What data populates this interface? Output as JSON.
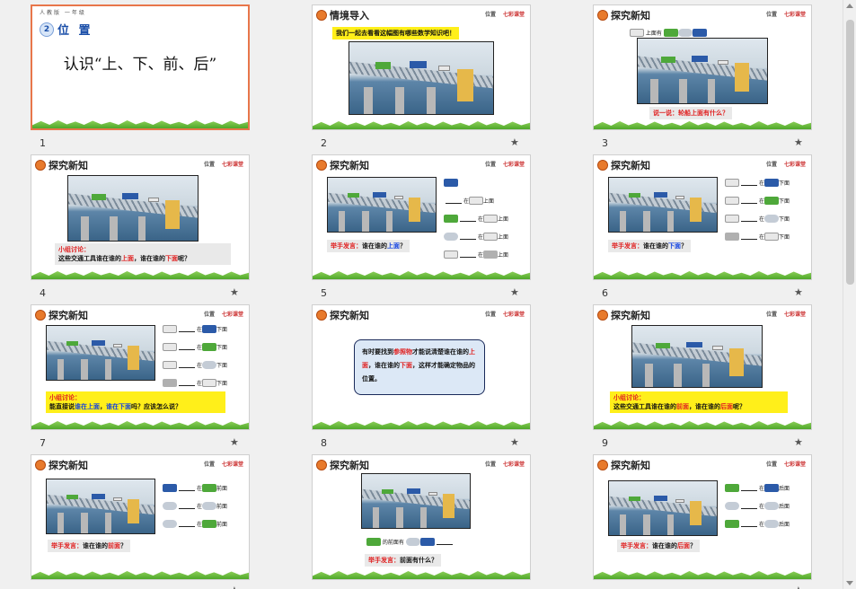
{
  "brand": {
    "prefix": "位置",
    "name": "七彩课堂"
  },
  "slides": [
    {
      "num": "1",
      "unit": "2",
      "unit_title": "位 置",
      "top_text": "人教版 一年级",
      "main_title": "认识“上、下、前、后”"
    },
    {
      "num": "2",
      "head": "情境导入",
      "banner": "我们一起去看看这幅图有哪些数学知识吧！"
    },
    {
      "num": "3",
      "head": "探究新知",
      "top_label": "上面有",
      "question": "说一说：轮船上面有什么？"
    },
    {
      "num": "4",
      "head": "探究新知",
      "disc_label": "小组讨论：",
      "disc_pre": "这些交通工具谁在谁的",
      "disc_up": "上面",
      "disc_mid": "，谁在谁的",
      "disc_down": "下面",
      "disc_end": "呢？"
    },
    {
      "num": "5",
      "head": "探究新知",
      "rows_word": "在",
      "rows_pos": "上面",
      "ask_label": "举手发言：",
      "ask_pre": "谁在谁的",
      "ask_key": "上面",
      "ask_end": "？"
    },
    {
      "num": "6",
      "head": "探究新知",
      "rows_word": "在",
      "rows_pos": "下面",
      "ask_label": "举手发言：",
      "ask_pre": "谁在谁的",
      "ask_key": "下面",
      "ask_end": "？"
    },
    {
      "num": "7",
      "head": "探究新知",
      "rows_word": "在",
      "rows_pos": "下面",
      "disc_label": "小组讨论：",
      "disc_pre": "能直接说",
      "disc_up": "谁在上面",
      "disc_mid": "，",
      "disc_down": "谁在下面",
      "disc_end": "吗？应该怎么说？"
    },
    {
      "num": "8",
      "head": "探究新知",
      "note_1": "有时要找到",
      "note_key": "参照物",
      "note_2": "才能说清楚谁在谁的",
      "note_up": "上面",
      "note_3": "，谁在谁的",
      "note_down": "下面",
      "note_4": "，这样才能确定物品的位置。"
    },
    {
      "num": "9",
      "head": "探究新知",
      "disc_label": "小组讨论：",
      "disc_pre": "这些交通工具谁在谁的",
      "disc_up": "前面",
      "disc_mid": "，谁在谁的",
      "disc_down": "后面",
      "disc_end": "呢？"
    },
    {
      "num": "10",
      "head": "探究新知",
      "rows_word": "在",
      "rows_pos": "前面",
      "ask_label": "举手发言：",
      "ask_pre": "谁在谁的",
      "ask_key": "前面",
      "ask_end": "？"
    },
    {
      "num": "11",
      "head": "探究新知",
      "bottom_label": "的前面有",
      "ask_label": "举手发言：",
      "ask_pre": "前面有什么",
      "ask_key": "",
      "ask_end": "？"
    },
    {
      "num": "12",
      "head": "探究新知",
      "rows_word": "在",
      "rows_pos": "后面",
      "ask_label": "举手发言：",
      "ask_pre": "谁在谁的",
      "ask_key": "后面",
      "ask_end": "？"
    }
  ],
  "star_glyph": "★"
}
